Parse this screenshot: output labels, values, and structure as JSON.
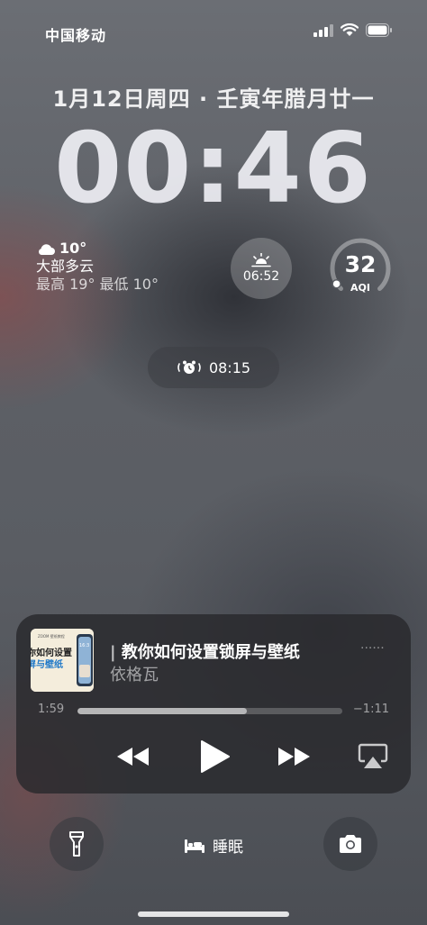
{
  "status_bar": {
    "carrier": "中国移动",
    "icons": [
      "cellular-signal-icon",
      "wifi-icon",
      "battery-icon"
    ]
  },
  "lock_screen": {
    "date": "1月12日周四 · 壬寅年腊月廿一",
    "time": "00:46"
  },
  "widgets": {
    "weather": {
      "icon": "partly-cloudy-icon",
      "temperature": "10°",
      "condition": "大部多云",
      "range": "最高 19° 最低 10°"
    },
    "sunrise": {
      "icon": "sunrise-icon",
      "time": "06:52"
    },
    "aqi": {
      "value": "32",
      "label": "AQI",
      "level_fraction": 0.05
    },
    "alarm": {
      "icon": "alarm-icon",
      "time": "08:15"
    }
  },
  "now_playing": {
    "cover_title": "教你如何设置锁屏与壁纸",
    "cover_text": "你如何设置\n屏与壁纸",
    "cover_tag": "ZOOM 壁纸教程",
    "cover_phone_time": "16:3",
    "title": "教你如何设置锁屏与壁纸",
    "artist": "依格瓦",
    "elapsed": "1:59",
    "remaining": "−1:11",
    "progress_fraction": 0.64,
    "more": "······",
    "controls": [
      "rewind-icon",
      "play-icon",
      "fast-forward-icon",
      "airplay-icon"
    ]
  },
  "bottom_bar": {
    "flashlight_icon": "flashlight-icon",
    "focus_icon": "bed-icon",
    "focus_label": "睡眠",
    "camera_icon": "camera-icon"
  },
  "colors": {
    "accent_white": "#ffffff",
    "player_bg": "#28282c",
    "cover_bg": "#f4eddc"
  }
}
